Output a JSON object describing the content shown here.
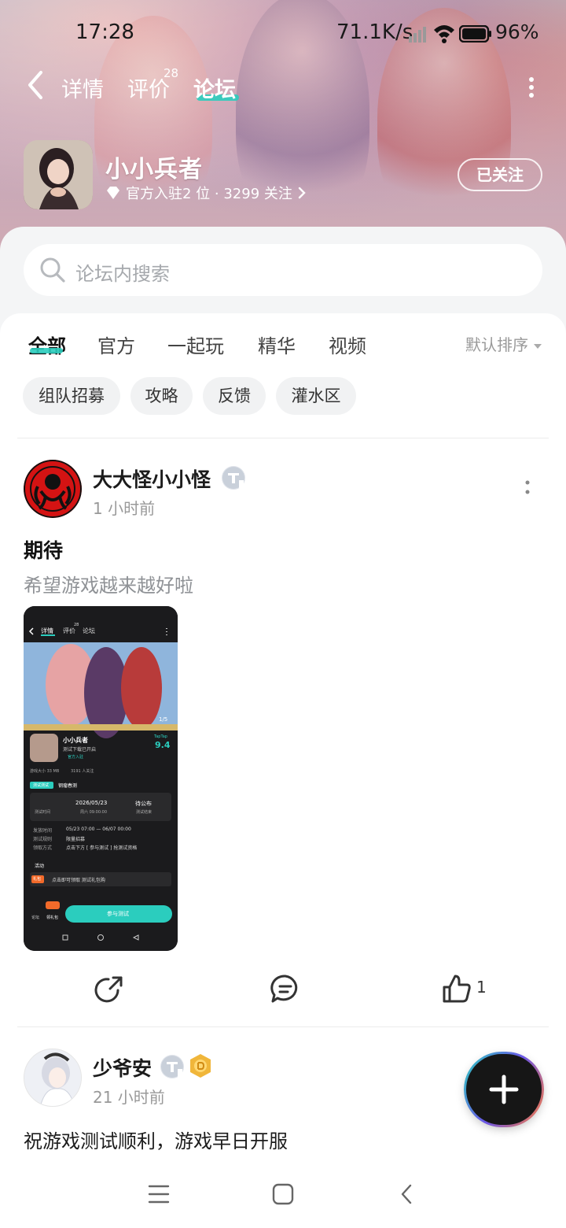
{
  "status_bar": {
    "time": "17:28",
    "network_speed": "71.1K/s",
    "battery": "96%"
  },
  "nav": {
    "tabs": [
      {
        "label": "详情"
      },
      {
        "label": "评价",
        "badge": "28"
      },
      {
        "label": "论坛"
      }
    ],
    "active_tab": "论坛"
  },
  "game": {
    "name": "小小兵者",
    "meta": "官方入驻2 位 · 3299 关注",
    "follow_label": "已关注"
  },
  "search": {
    "placeholder": "论坛内搜索"
  },
  "filter_tabs": [
    "全部",
    "官方",
    "一起玩",
    "精华",
    "视频"
  ],
  "sort_label": "默认排序",
  "chips": [
    "组队招募",
    "攻略",
    "反馈",
    "灌水区"
  ],
  "posts": [
    {
      "author": "大大怪小小怪",
      "time": "1 小时前",
      "title": "期待",
      "body": "希望游戏越来越好啦",
      "like_count": "1",
      "screenshot": {
        "tabs": [
          "详情",
          "评价",
          "论坛"
        ],
        "tab_badge": "28",
        "page_indicator": "1/5",
        "game_name": "小小兵者",
        "subtitle": "测试下载已开启",
        "official": "官方入驻",
        "score_brand": "TapTap",
        "score": "9.4",
        "size_text": "游戏大小 33 MB",
        "follow_text": "3191 人关注",
        "test_tag": "测试测试",
        "test_name": "钢瘤春测",
        "start_label": "测试时间",
        "start_date": "2026/05/23",
        "start_sub": "周六 09:00:00",
        "end_value": "待公布",
        "end_sub": "测试结束",
        "rows": [
          {
            "k": "发放时间",
            "v": "05/23 07:00 — 06/07 00:00"
          },
          {
            "k": "测试规则",
            "v": "限量招募"
          },
          {
            "k": "领取方式",
            "v": "点击下方 [ 参与测试 ] 抢测试资格"
          }
        ],
        "activity": "活动",
        "gift_tag": "礼包",
        "gift_text": "点击即可领取 测试礼包购",
        "forum_label": "论坛",
        "gift_label": "领礼包",
        "join_label": "参与测试"
      }
    },
    {
      "author": "少爷安",
      "time": "21 小时前",
      "body": "祝游戏测试顺利，游戏早日开服"
    }
  ],
  "colors": {
    "accent": "#2bcdbe",
    "badge_gold": "#f0b63a"
  }
}
